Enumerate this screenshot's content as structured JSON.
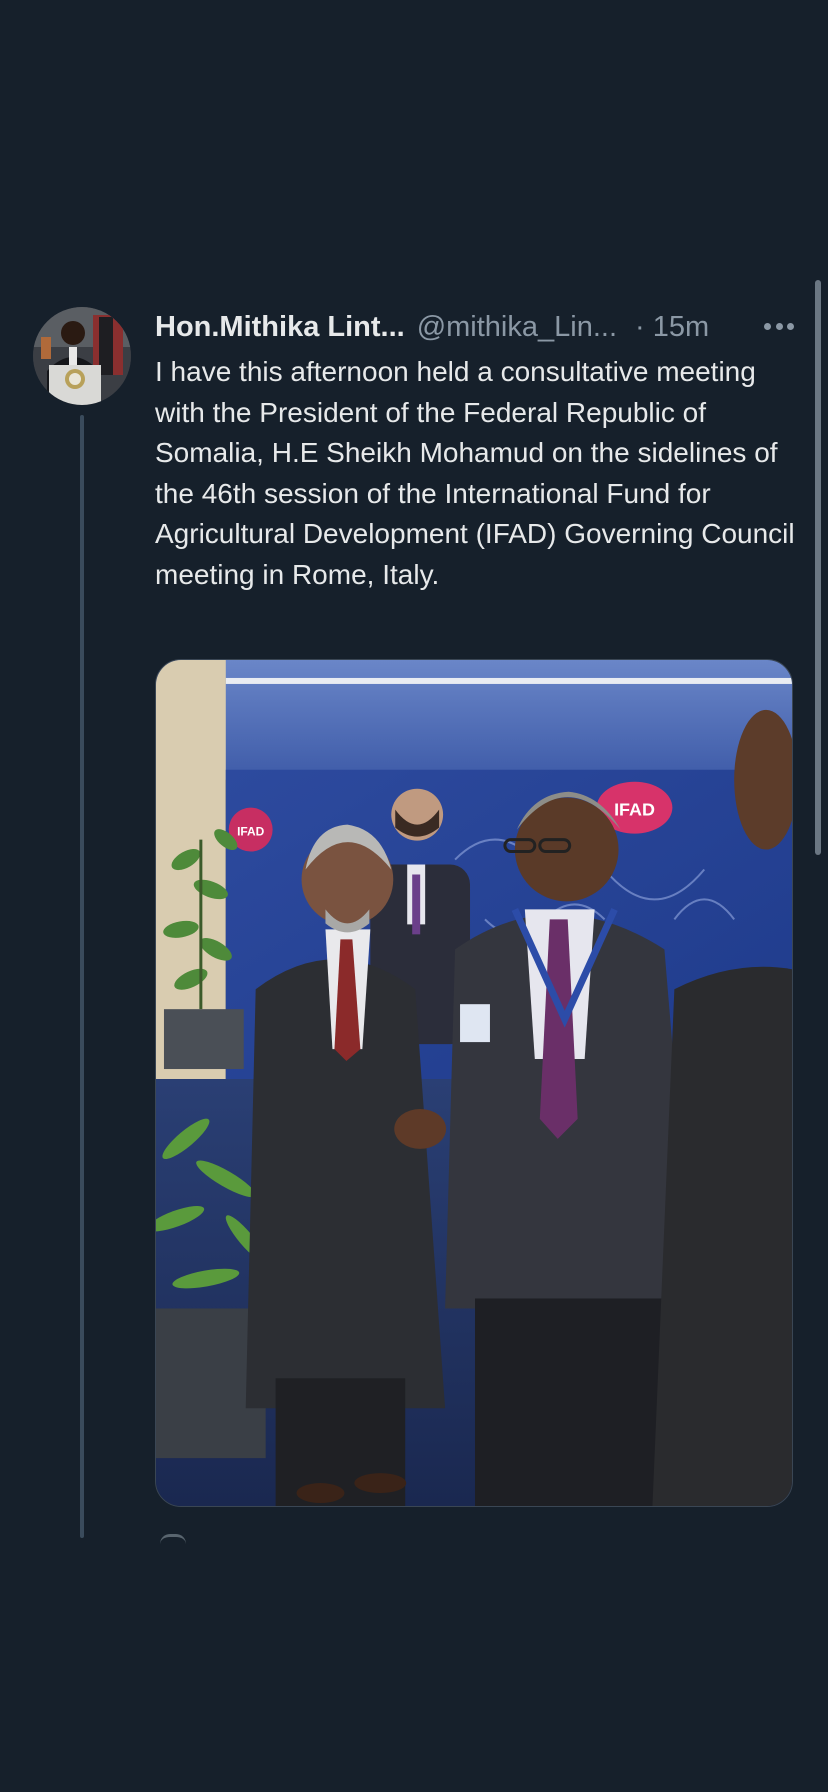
{
  "tweet": {
    "display_name": "Hon.Mithika Lint...",
    "handle": "@mithika_Lin...",
    "time": "· 15m",
    "text": "I have this afternoon held a consultative meeting with the President of the Federal Republic of Somalia, H.E Sheikh Mohamud on the sidelines of the 46th session of the International Fund for Agricultural Development (IFAD) Governing Council meeting in Rome, Italy.",
    "media": {
      "banner_text": "IFAD",
      "banner_text_small": "IFAD"
    },
    "icons": {
      "more": "more-horizontal-icon"
    }
  },
  "colors": {
    "background": "#16202b",
    "primary_text": "#e7e9ea",
    "secondary_text": "#8b98a5",
    "thread_line": "#3a4b5c"
  }
}
